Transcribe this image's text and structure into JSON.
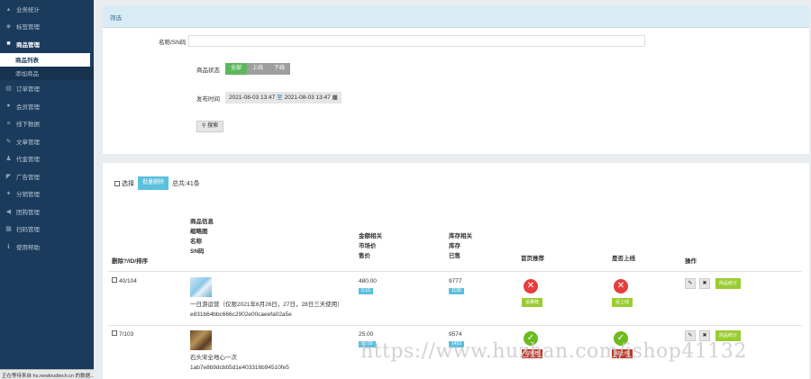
{
  "sidebar": {
    "items": [
      {
        "label": "业务统计",
        "icon": "chart-icon"
      },
      {
        "label": "标签管理",
        "icon": "tag-icon"
      },
      {
        "label": "商品管理",
        "icon": "boxes-icon",
        "active": true
      },
      {
        "label": "订单管理",
        "icon": "cart-icon"
      },
      {
        "label": "会员管理",
        "icon": "users-icon"
      },
      {
        "label": "线下数据",
        "icon": "list-icon"
      },
      {
        "label": "文章管理",
        "icon": "pen-icon"
      },
      {
        "label": "代金管理",
        "icon": "user-icon"
      },
      {
        "label": "广告管理",
        "icon": "megaphone-icon"
      },
      {
        "label": "分销管理",
        "icon": "share-icon"
      },
      {
        "label": "团购管理",
        "icon": "rewind-icon"
      },
      {
        "label": "扫码管理",
        "icon": "grid-icon"
      },
      {
        "label": "使用帮助",
        "icon": "info-icon"
      }
    ],
    "subitems": [
      {
        "label": "商品列表",
        "selected": true
      },
      {
        "label": "添加商品",
        "selected": false
      }
    ],
    "status_text": "正在等待来自 hs.newloudtech.cn 的数据..."
  },
  "filter": {
    "header": "筛选",
    "name_label": "名称/SN码",
    "state_label": "商品状态",
    "state_options": [
      "全部",
      "上线",
      "下线"
    ],
    "date_label": "发布时间",
    "date_from": "2021-08-03 13:47",
    "date_to_sep": "至",
    "date_to": "2021-08-03 13:47",
    "search_button": "搜索"
  },
  "list": {
    "select_label": "选择",
    "batch_delete": "批量删除",
    "total": "总共:41条",
    "headers": {
      "col_id": "删除?/ID/排序",
      "col_product": [
        "商品信息",
        "缩略图",
        "名称",
        "SN码"
      ],
      "col_price": [
        "金额相关",
        "市场价",
        "售价"
      ],
      "col_stock": [
        "库存相关",
        "库存",
        "已售"
      ],
      "col_home": "首页推荐",
      "col_online": "是否上线",
      "col_action": "操作"
    },
    "stats_button": "商品统计",
    "rows": [
      {
        "id": "40/104",
        "name": "一日游运营（仅限2021年6月26日，27日，28日三天使用）",
        "sn": "e831b64bbc666c2902e00caeefa02a5e",
        "market_price": "480.00",
        "price": "0.10",
        "stock": "9777",
        "sold": "1199",
        "home_btn": "设推荐",
        "online_btn": "设上线",
        "home_flag": "no",
        "online_flag": "no"
      },
      {
        "id": "7/103",
        "name": "石头宋全地心一次",
        "sn": "1ab7e8b9dcbb5d1e403316b94510fe5",
        "market_price": "25.00",
        "price": "20.00",
        "stock": "9574",
        "sold": "1452",
        "home_btn": "取推荐",
        "online_btn": "取上线",
        "home_flag": "yes",
        "online_flag": "yes"
      }
    ]
  },
  "watermark": "https://www.huzhan.com/ishop41132",
  "colors": {
    "sidebar_bg": "#1b3b5c",
    "filter_header_bg": "#d9ecf5",
    "active_green": "#5cb85c",
    "info_blue": "#5bc0de",
    "no_red": "#e53e3e",
    "yes_green": "#6dbb1f",
    "action_green": "#9acd32"
  }
}
